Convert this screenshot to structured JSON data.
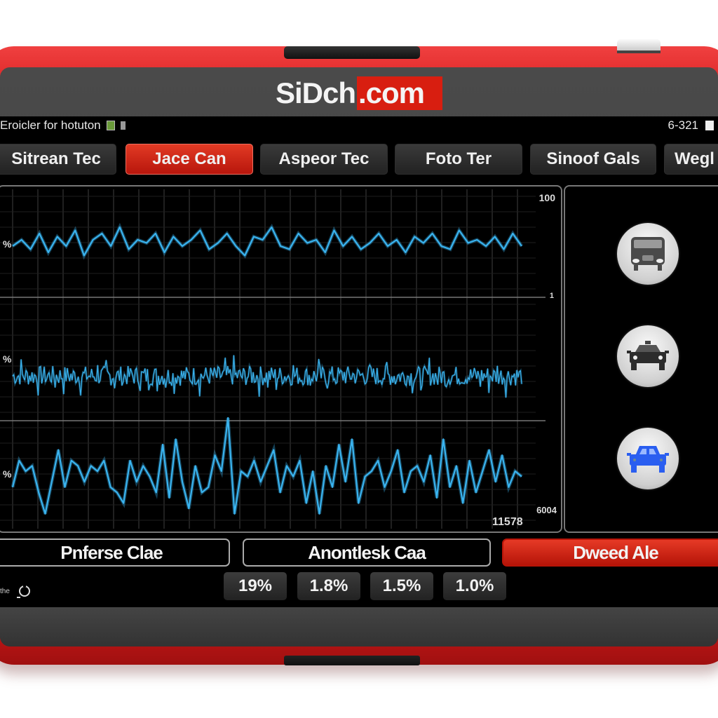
{
  "header": {
    "logo_main": "SiDch",
    "logo_suffix": ".com",
    "brand_color": "#d81e10"
  },
  "statusbar": {
    "left_text": "Eroicler for hotuton",
    "right_text": "6-321"
  },
  "tabs": [
    {
      "label": "Sitrean Tec",
      "active": false
    },
    {
      "label": "Jace Can",
      "active": true
    },
    {
      "label": "Aspeor Tec",
      "active": false
    },
    {
      "label": "Foto Ter",
      "active": false
    },
    {
      "label": "Sinoof Gals",
      "active": false
    },
    {
      "label": "Wegl",
      "active": false
    }
  ],
  "chart_data": {
    "type": "line",
    "title": "",
    "axis_labels": {
      "top_right": "100",
      "mid_right": "1",
      "bottom_right": "6004",
      "bottom_value": "11578",
      "left_marks": [
        "%",
        "%",
        "%"
      ]
    },
    "series": [
      {
        "name": "trace-1",
        "color": "#3ab4f0",
        "values": [
          0.5,
          0.6,
          0.45,
          0.7,
          0.4,
          0.65,
          0.5,
          0.75,
          0.35,
          0.6,
          0.7,
          0.5,
          0.8,
          0.45,
          0.6,
          0.55,
          0.7,
          0.4,
          0.65,
          0.5,
          0.6,
          0.75,
          0.45,
          0.55,
          0.7,
          0.5,
          0.35,
          0.65,
          0.6,
          0.8,
          0.5,
          0.45,
          0.7,
          0.55,
          0.6,
          0.4,
          0.75,
          0.5,
          0.65,
          0.45,
          0.55,
          0.7,
          0.5,
          0.6,
          0.4,
          0.65,
          0.55,
          0.7,
          0.5,
          0.45,
          0.75,
          0.55,
          0.6,
          0.5,
          0.65,
          0.45,
          0.7,
          0.5
        ]
      },
      {
        "name": "trace-2",
        "color": "#3ab4f0",
        "noise": true,
        "baseline": 0.5,
        "amplitude": 0.35
      },
      {
        "name": "trace-3",
        "color": "#3ab4f0",
        "values": [
          0.35,
          0.6,
          0.5,
          0.55,
          0.3,
          0.1,
          0.4,
          0.7,
          0.35,
          0.6,
          0.55,
          0.4,
          0.55,
          0.5,
          0.6,
          0.35,
          0.3,
          0.2,
          0.6,
          0.4,
          0.55,
          0.45,
          0.3,
          0.75,
          0.25,
          0.8,
          0.4,
          0.15,
          0.55,
          0.3,
          0.35,
          0.65,
          0.5,
          1.0,
          0.1,
          0.5,
          0.45,
          0.6,
          0.4,
          0.55,
          0.7,
          0.3,
          0.55,
          0.45,
          0.6,
          0.2,
          0.5,
          0.1,
          0.55,
          0.35,
          0.75,
          0.4,
          0.8,
          0.2,
          0.45,
          0.5,
          0.6,
          0.35,
          0.5,
          0.7,
          0.3,
          0.5,
          0.55,
          0.4,
          0.65,
          0.25,
          0.8,
          0.35,
          0.55,
          0.2,
          0.6,
          0.3,
          0.5,
          0.7,
          0.4,
          0.65,
          0.35,
          0.5,
          0.45
        ]
      }
    ]
  },
  "side_panel": {
    "vehicles": [
      {
        "icon": "truck-icon",
        "color": "#4a4a4a"
      },
      {
        "icon": "taxi-icon",
        "color": "#333333"
      },
      {
        "icon": "car-icon",
        "color": "#2a5ef0",
        "selected": true
      }
    ]
  },
  "bottom": {
    "buttons": [
      {
        "label": "Pnferse Clae",
        "active": false
      },
      {
        "label": "Anontlesk Caa",
        "active": false
      },
      {
        "label": "Dweed Ale",
        "active": true
      }
    ],
    "refresh_label": "the",
    "percentages": [
      "19%",
      "1.8%",
      "1.5%",
      "1.0%"
    ]
  }
}
